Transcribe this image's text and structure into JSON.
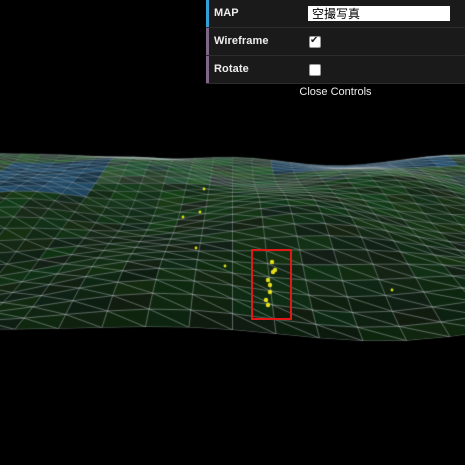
{
  "gui": {
    "rows": [
      {
        "label": "MAP",
        "type": "text",
        "value": "空撮写真",
        "accent": "#2fa1d6"
      },
      {
        "label": "Wireframe",
        "type": "checkbox",
        "checked": true,
        "accent": "#806787"
      },
      {
        "label": "Rotate",
        "type": "checkbox",
        "checked": false,
        "accent": "#806787"
      }
    ],
    "close_label": "Close Controls"
  },
  "scene": {
    "background": "#000000",
    "wire_color": "#d8dde6",
    "terrain_green": "#2e5a34",
    "water_blue": "#2b5f82",
    "marker_color": "#e6e01a",
    "highlight_color": "#e01818"
  }
}
